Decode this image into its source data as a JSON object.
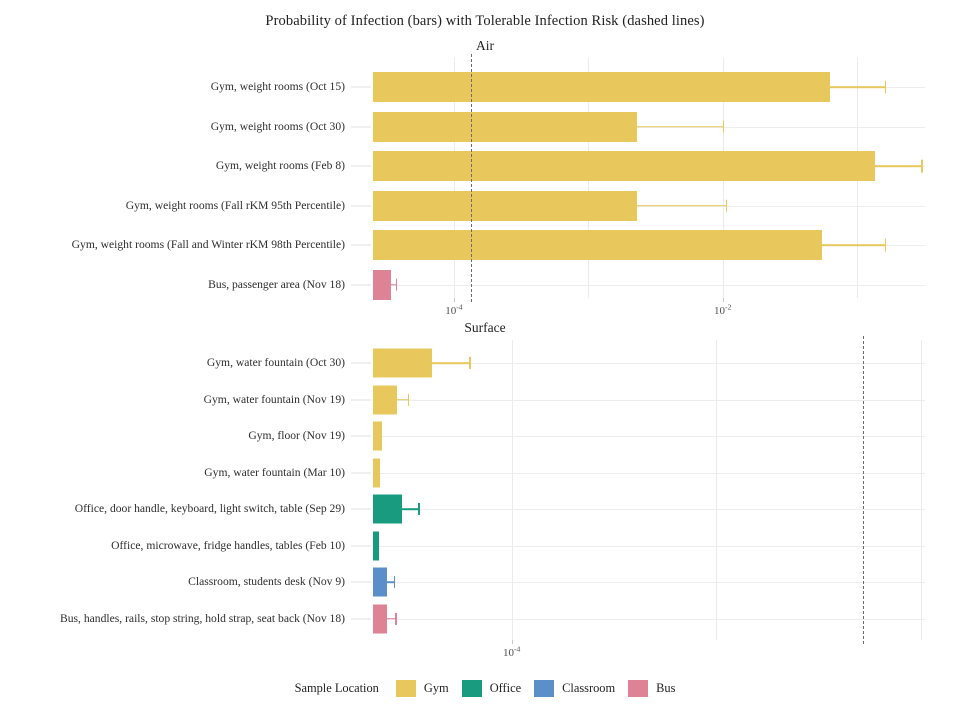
{
  "chart_data": {
    "type": "bar",
    "orientation": "horizontal",
    "title": "Probability of Infection (bars) with Tolerable Infection Risk (dashed lines)",
    "xlabel": "",
    "ylabel": "",
    "xscale": "log",
    "grid": true,
    "legend": {
      "position": "bottom",
      "title": "Sample Location",
      "entries": [
        {
          "name": "Gym",
          "color": "#E8C85C"
        },
        {
          "name": "Office",
          "color": "#189B7E"
        },
        {
          "name": "Classroom",
          "color": "#5B8FC9"
        },
        {
          "name": "Bus",
          "color": "#DE8296"
        }
      ]
    },
    "panels": [
      {
        "facet": "Air",
        "xlim": [
          2.5e-05,
          0.32
        ],
        "xticks": [
          {
            "value": 0.0001,
            "label_mantissa": "10",
            "label_exponent": "-4"
          },
          {
            "value": 0.01,
            "label_mantissa": "10",
            "label_exponent": "-2"
          }
        ],
        "threshold_line": 0.000135,
        "categories": [
          "Gym, weight rooms (Oct 15)",
          "Gym, weight rooms (Oct 30)",
          "Gym, weight rooms (Feb 8)",
          "Gym, weight rooms (Fall rKM 95th Percentile)",
          "Gym, weight rooms (Fall and Winter rKM 98th Percentile)",
          "Bus, passenger area (Nov 18)"
        ],
        "groups": [
          "Gym",
          "Gym",
          "Gym",
          "Gym",
          "Gym",
          "Bus"
        ],
        "values": [
          0.063,
          0.0023,
          0.135,
          0.0023,
          0.055,
          3.4e-05
        ],
        "errors_upper": [
          0.16,
          0.01,
          0.3,
          0.0105,
          0.16,
          3.7e-05
        ]
      },
      {
        "facet": "Surface",
        "xlim": [
          2.1e-05,
          0.0105
        ],
        "xticks": [
          {
            "value": 0.0001,
            "label_mantissa": "10",
            "label_exponent": "-4"
          }
        ],
        "threshold_line": 0.0052,
        "categories": [
          "Gym, water fountain (Oct 30)",
          "Gym, water fountain (Nov 19)",
          "Gym, floor (Nov 19)",
          "Gym, water fountain (Mar 10)",
          "Office, door handle, keyboard, light switch, table (Sep 29)",
          "Office, microwave, fridge handles, tables  (Feb 10)",
          "Classroom, students desk (Nov 9)",
          "Bus, handles, rails, stop string, hold strap, seat back (Nov 18)"
        ],
        "groups": [
          "Gym",
          "Gym",
          "Gym",
          "Gym",
          "Office",
          "Office",
          "Classroom",
          "Bus"
        ],
        "values": [
          4.1e-05,
          2.75e-05,
          2.32e-05,
          2.28e-05,
          2.9e-05,
          2.25e-05,
          2.45e-05,
          2.45e-05
        ],
        "errors_upper": [
          6.2e-05,
          3.1e-05,
          2.32e-05,
          2.28e-05,
          3.5e-05,
          2.25e-05,
          2.65e-05,
          2.7e-05
        ]
      }
    ]
  }
}
